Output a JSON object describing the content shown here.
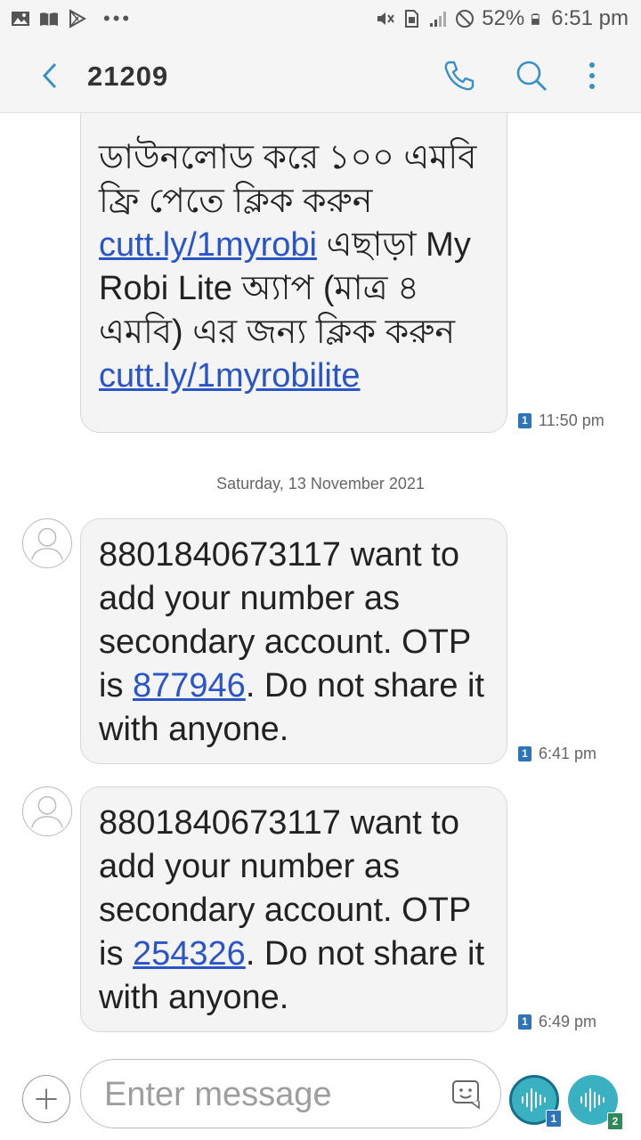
{
  "status_bar": {
    "left_icons": [
      "gallery-icon",
      "book-icon",
      "play-store-icon",
      "more-notifications-icon"
    ],
    "right_icons": [
      "mute-vibrate-icon",
      "sim-icon",
      "signal-icon",
      "no-sim-icon",
      "battery-icon"
    ],
    "battery": "52%",
    "time": "6:51 pm"
  },
  "header": {
    "title": "21209",
    "icons": [
      "back-icon",
      "phone-icon",
      "search-icon",
      "more-vert-icon"
    ]
  },
  "messages": [
    {
      "text_parts": [
        {
          "text": "ডাউনলোড করে ১০০ এমবি  ফ্রি পেতে ক্লিক করুন "
        },
        {
          "text": "cutt.ly/1myrobi",
          "link": true
        },
        {
          "text": " এছাড়া My Robi Lite অ্যাপ (মাত্র ৪ এমবি) এর জন্য ক্লিক করুন "
        },
        {
          "text": "cutt.ly/1myrobilite",
          "link": true
        }
      ],
      "time": "11:50 pm",
      "sim": "1"
    },
    {
      "text_parts": [
        {
          "text": "8801840673117 want to add your number as secondary account. OTP is "
        },
        {
          "text": "877946",
          "link": true
        },
        {
          "text": ". Do not share it with anyone."
        }
      ],
      "time": "6:41 pm",
      "sim": "1"
    },
    {
      "text_parts": [
        {
          "text": "8801840673117 want to add your number as secondary account. OTP is "
        },
        {
          "text": "254326",
          "link": true
        },
        {
          "text": ". Do not share it with anyone."
        }
      ],
      "time": "6:49 pm",
      "sim": "1"
    }
  ],
  "date_separator": "Saturday, 13 November 2021",
  "composer": {
    "placeholder": "Enter message",
    "send_sim1": "1",
    "send_sim2": "2"
  },
  "colors": {
    "accent": "#3a8fc4",
    "link": "#2a55c8",
    "send_button": "#3ab1c0",
    "sim1_badge": "#2f73b8",
    "sim2_badge": "#2e8b57"
  }
}
